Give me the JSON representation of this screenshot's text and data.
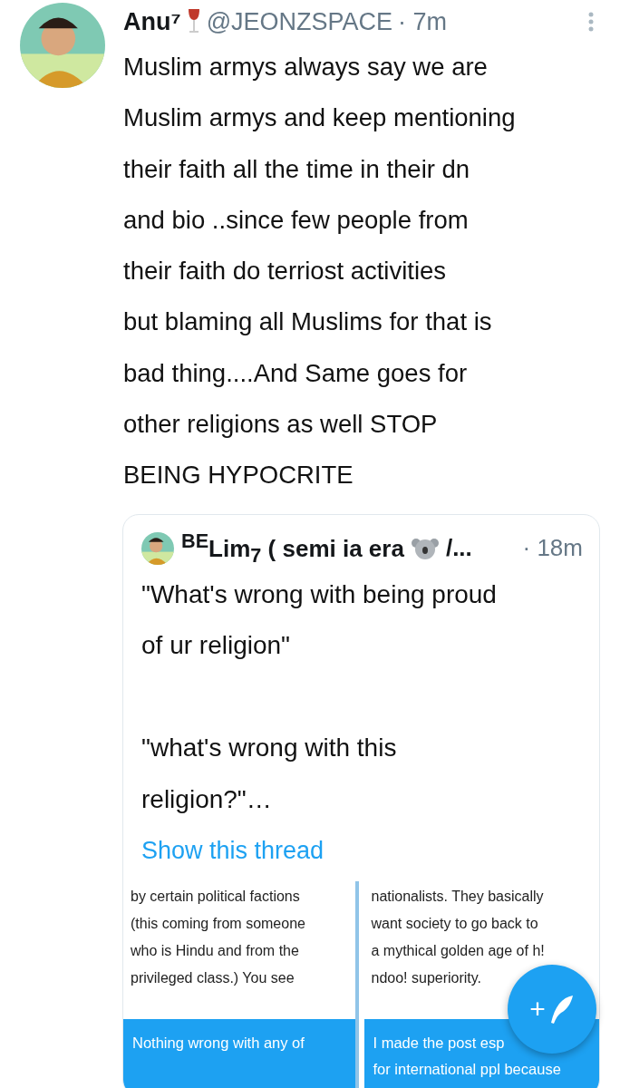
{
  "tweet": {
    "name": "Anu⁷",
    "handle": "@JEONZSPACE",
    "time": "· 7m",
    "text": "Muslim armys always say we are\nMuslim armys and keep mentioning\ntheir faith all the time in their dn\nand bio ..since few people from\ntheir faith do terriost activities\nbut blaming all Muslims for that is\nbad thing....And Same goes for\nother religions as well STOP\nBEING HYPOCRITE",
    "quote": {
      "name": "$^{BE}$Lim$_{7}$ ( semi ia era",
      "name_tail": "/...",
      "time": "· 18m",
      "text": "\"What's wrong with being proud\nof ur religion\"\n\n\"what's wrong with this\nreligion?\"…",
      "link": "Show this thread",
      "images": [
        {
          "text": "by certain political factions\n(this coming from someone\nwho is Hindu and from the\nprivileged class.) You see",
          "bubble": "Nothing wrong with any of",
          "scrollbar": true
        },
        {
          "text": "nationalists. They basically\nwant society to go back to\na mythical golden age of h!\nndoo! superiority.",
          "bubble": "I made the post esp\nfor international ppl because",
          "scrollbar": false
        }
      ]
    }
  },
  "compose_button": {
    "label": "+"
  }
}
